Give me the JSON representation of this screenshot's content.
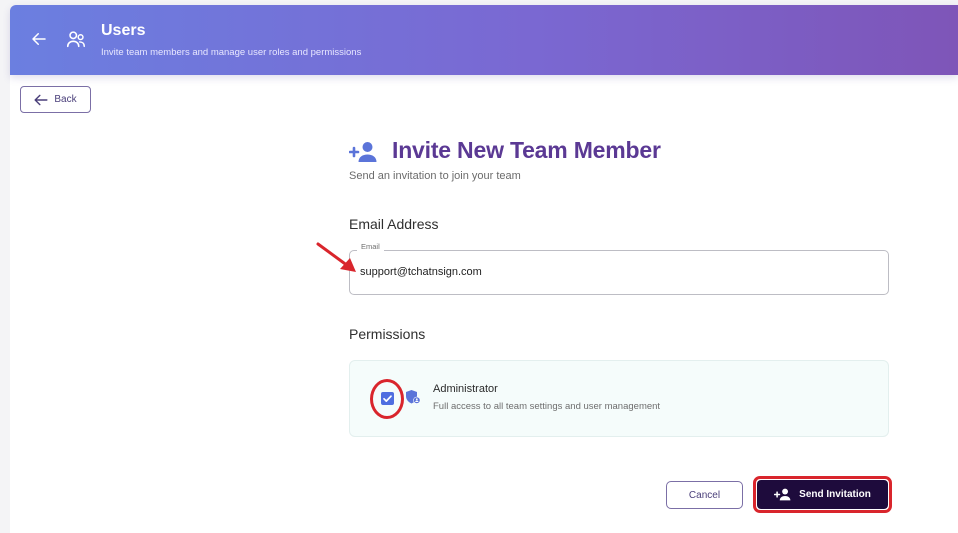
{
  "header": {
    "title": "Users",
    "subtitle": "Invite team members and manage user roles and permissions",
    "back_icon": "arrow-left-icon",
    "users_icon": "users-icon"
  },
  "back_button": {
    "label": "Back",
    "icon": "arrow-left-icon"
  },
  "invite": {
    "title": "Invite New Team Member",
    "subtitle": "Send an invitation to join your team",
    "icon": "person-add-icon"
  },
  "email_section": {
    "label": "Email Address",
    "field_legend": "Email",
    "value": "support@tchatnsign.com"
  },
  "permissions": {
    "label": "Permissions",
    "items": [
      {
        "title": "Administrator",
        "description": "Full access to all team settings and user management",
        "checked": true,
        "icon": "shield-person-icon"
      }
    ]
  },
  "actions": {
    "cancel_label": "Cancel",
    "send_label": "Send Invitation",
    "send_icon": "person-add-icon"
  },
  "colors": {
    "header_gradient_start": "#6b7fe0",
    "header_gradient_end": "#7e55b8",
    "title_purple": "#5b3994",
    "checkbox_blue": "#4f6ee0",
    "send_button_bg": "#1e0b3c",
    "annotation_red": "#d9252c"
  }
}
